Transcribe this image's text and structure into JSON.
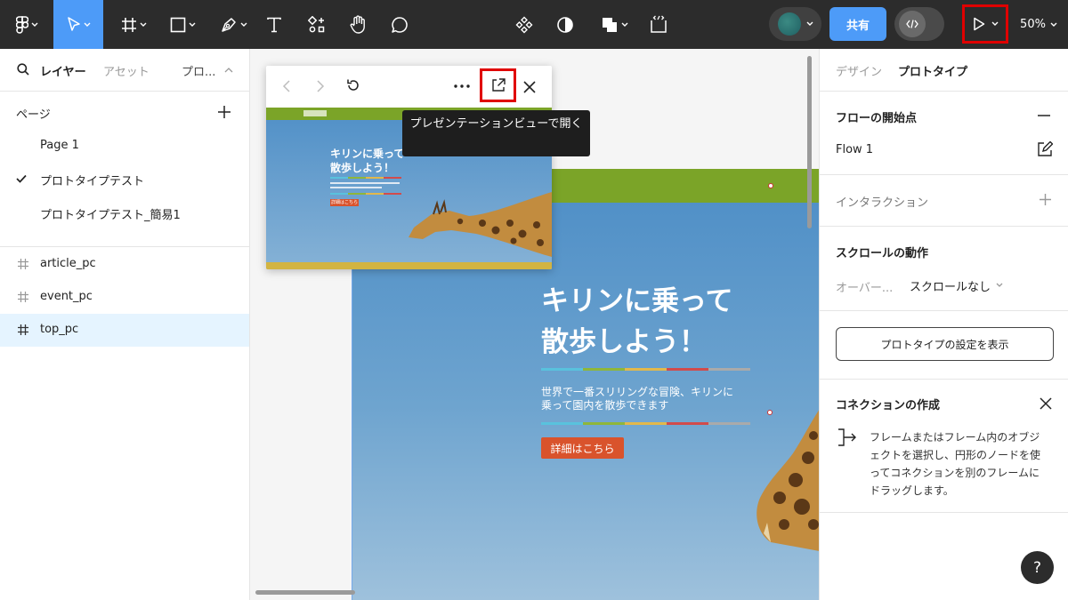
{
  "toolbar": {
    "share_label": "共有",
    "zoom_label": "50%",
    "icons": [
      "figma-menu-icon",
      "move-tool-icon",
      "frame-tool-icon",
      "shape-tool-icon",
      "pen-tool-icon",
      "text-tool-icon",
      "resources-icon",
      "hand-tool-icon",
      "comment-tool-icon",
      "component-icon",
      "contrast-icon",
      "boolean-icon",
      "dev-mode-icon",
      "code-toggle-icon",
      "present-play-icon"
    ],
    "highlight_color": "#e00000",
    "accent": "#4d9bf8"
  },
  "left_panel": {
    "tabs": {
      "layers": "レイヤー",
      "assets": "アセット",
      "current_page_short": "プロ..."
    },
    "pages_heading": "ページ",
    "pages": [
      {
        "label": "Page 1",
        "checked": false
      },
      {
        "label": "プロトタイプテスト",
        "checked": true
      },
      {
        "label": "プロトタイプテスト_簡易1",
        "checked": false
      }
    ],
    "layers": [
      {
        "label": "article_pc",
        "selected": false
      },
      {
        "label": "event_pc",
        "selected": false
      },
      {
        "label": "top_pc",
        "selected": true
      }
    ]
  },
  "preview": {
    "tooltip": "プレゼンテーションビューで開く",
    "thumb_title": "キリンに乗って\n散歩しよう！",
    "thumb_button": "詳細はこちら"
  },
  "canvas": {
    "hero_title_line1": "キリンに乗って",
    "hero_title_line2": "散歩しよう！",
    "hero_sub_line1": "世界で一番スリリングな冒険、キリンに",
    "hero_sub_line2": "乗って園内を散歩できます",
    "hero_button": "詳細はこちら",
    "header_green": "#7ba428",
    "button_color": "#d9532c"
  },
  "right_panel": {
    "tabs": {
      "design": "デザイン",
      "prototype": "プロトタイプ"
    },
    "flow_heading": "フローの開始点",
    "flow_name": "Flow 1",
    "interaction_heading": "インタラクション",
    "scroll_heading": "スクロールの動作",
    "overflow_label": "オーバー...",
    "overflow_value": "スクロールなし",
    "settings_button": "プロトタイプの設定を表示",
    "connection_heading": "コネクションの作成",
    "connection_help": [
      "フレームまたはフレーム内のオブジ",
      "ェクトを選択し、円形のノードを使",
      "ってコネクションを別のフレームに",
      "ドラッグします。"
    ],
    "help_label": "?"
  }
}
